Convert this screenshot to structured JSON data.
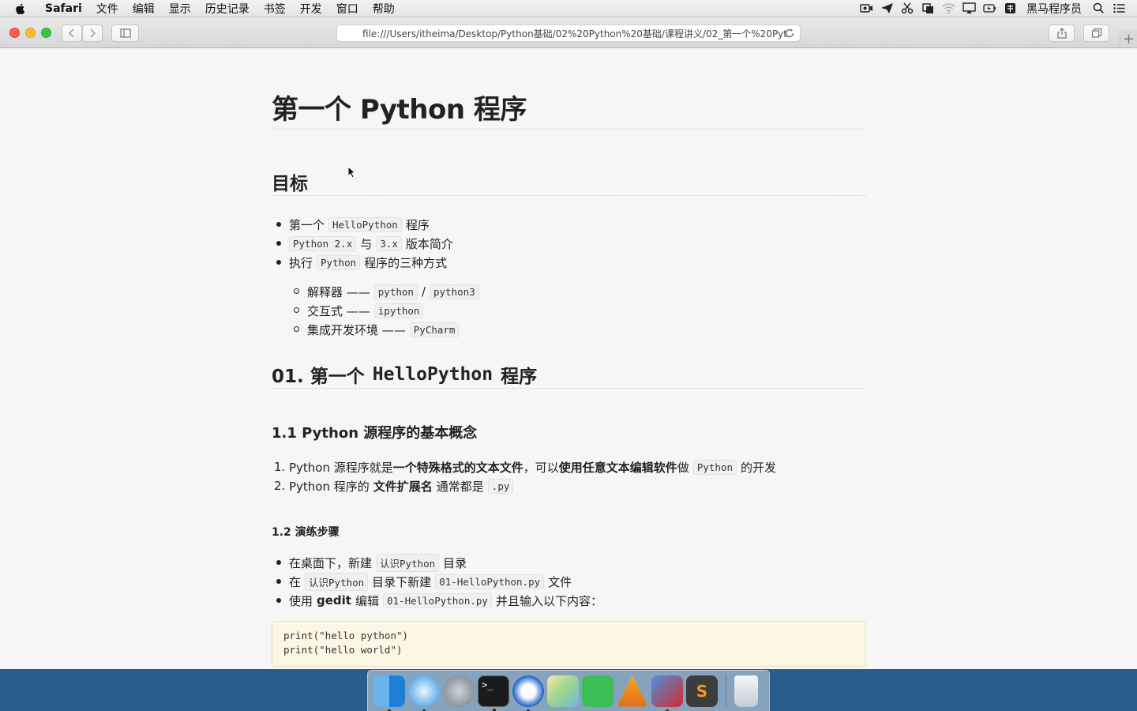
{
  "menubar": {
    "app_name": "Safari",
    "items": [
      "文件",
      "编辑",
      "显示",
      "历史记录",
      "书签",
      "开发",
      "窗口",
      "帮助"
    ],
    "status_user": "黑马程序员"
  },
  "browser": {
    "address": "file:///Users/itheima/Desktop/Python基础/02%20Python%20基础/课程讲义/02_第一个%20Pyt"
  },
  "doc": {
    "title": "第一个 Python 程序",
    "goal_heading": "目标",
    "goals": {
      "g1_pre": "第一个",
      "g1_code": "HelloPython",
      "g1_post": "程序",
      "g2_code1": "Python 2.x",
      "g2_mid": "与",
      "g2_code2": "3.x",
      "g2_post": "版本简介",
      "g3_pre": "执行",
      "g3_code": "Python",
      "g3_post": "程序的三种方式"
    },
    "modes": {
      "m1_pre": "解释器 ——",
      "m1_code1": "python",
      "m1_sep": "/",
      "m1_code2": "python3",
      "m2_pre": "交互式 ——",
      "m2_code": "ipython",
      "m3_pre": "集成开发环境 ——",
      "m3_code": "PyCharm"
    },
    "section1_prefix": "01. 第一个",
    "section1_code": "HelloPython",
    "section1_suffix": "程序",
    "sub1_heading": "1.1 Python 源程序的基本概念",
    "concepts": {
      "c1_num": "1.",
      "c1_pre": "Python 源程序就是",
      "c1_bold1": "一个特殊格式的文本文件",
      "c1_mid": "，可以",
      "c1_bold2": "使用任意文本编辑软件",
      "c1_mid2": "做",
      "c1_code": "Python",
      "c1_post": "的开发",
      "c2_num": "2.",
      "c2_pre": "Python 程序的",
      "c2_bold": "文件扩展名",
      "c2_mid": "通常都是",
      "c2_code": ".py"
    },
    "sub2_heading": "1.2 演练步骤",
    "steps": {
      "s1_pre": "在桌面下，新建",
      "s1_code": "认识Python",
      "s1_post": "目录",
      "s2_pre": "在",
      "s2_code1": "认识Python",
      "s2_mid": "目录下新建",
      "s2_code2": "01-HelloPython.py",
      "s2_post": "文件",
      "s3_pre": "使用",
      "s3_bold": "gedit",
      "s3_mid": "编辑",
      "s3_code": "01-HelloPython.py",
      "s3_post": "并且输入以下内容："
    },
    "code_block": "print(\"hello python\")\nprint(\"hello world\")"
  },
  "dock": {
    "apps": [
      "finder-icon",
      "safari-icon",
      "launchpad-icon",
      "terminal-icon",
      "pycharm-icon",
      "maps-icon",
      "xmind-icon",
      "vlc-icon",
      "vmware-icon",
      "sublime-icon",
      "trash-icon"
    ]
  }
}
